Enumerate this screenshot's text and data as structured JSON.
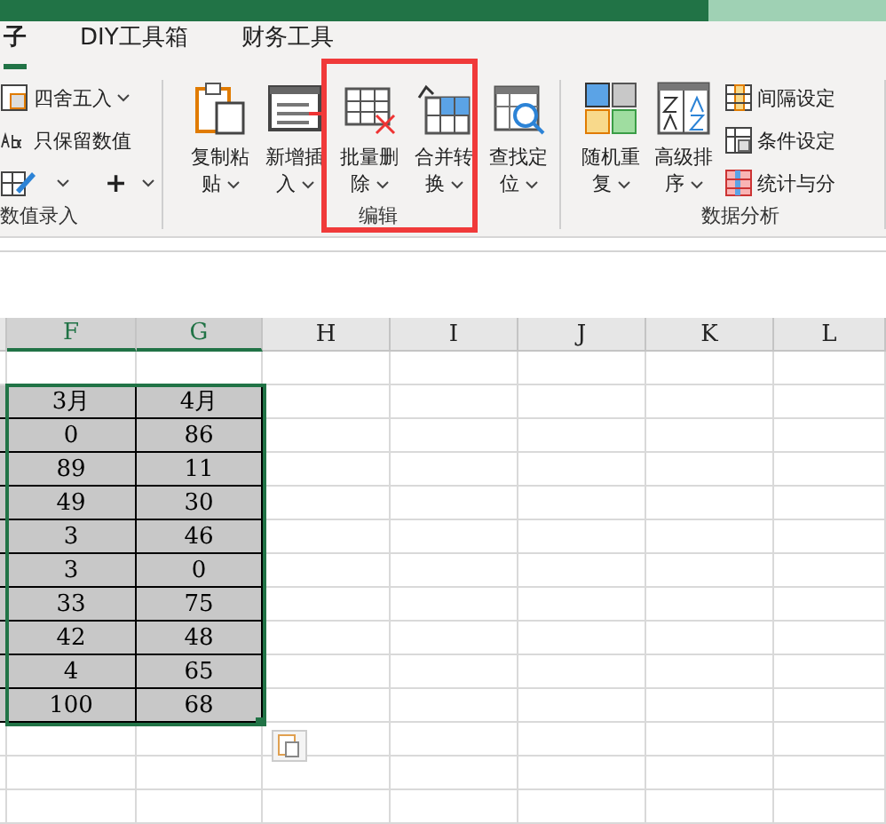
{
  "ribbon": {
    "tabs": [
      {
        "label": "子",
        "selected": true
      },
      {
        "label": "DIY工具箱",
        "selected": false
      },
      {
        "label": "财务工具",
        "selected": false
      }
    ],
    "groups": [
      {
        "name": "数值录入",
        "items": [
          {
            "kind": "small",
            "label": "四舍五入",
            "dropdown": true
          },
          {
            "kind": "small",
            "label": "只保留数值",
            "dropdown": false
          },
          {
            "kind": "pair",
            "label": "+",
            "dropdown": true
          }
        ]
      },
      {
        "name": "编辑",
        "items": [
          {
            "kind": "large",
            "label": "复制粘贴",
            "dropdown": true
          },
          {
            "kind": "large",
            "label": "新增插入",
            "dropdown": true
          },
          {
            "kind": "large",
            "label": "批量删除",
            "dropdown": true,
            "highlighted": true
          },
          {
            "kind": "large",
            "label": "合并转换",
            "dropdown": true,
            "highlighted": true
          },
          {
            "kind": "large",
            "label": "查找定位",
            "dropdown": true
          }
        ]
      },
      {
        "name": "数据分析",
        "items": [
          {
            "kind": "large",
            "label": "随机重复",
            "dropdown": true
          },
          {
            "kind": "large",
            "label": "高级排序",
            "dropdown": true
          },
          {
            "kind": "small",
            "label": "间隔设定",
            "dropdown": false
          },
          {
            "kind": "small",
            "label": "条件设定",
            "dropdown": false
          },
          {
            "kind": "small",
            "label": "统计与分",
            "dropdown": false
          }
        ]
      }
    ]
  },
  "sheet": {
    "columns": [
      {
        "label": "F",
        "selected": true
      },
      {
        "label": "G",
        "selected": true
      },
      {
        "label": "H",
        "selected": false
      },
      {
        "label": "I",
        "selected": false
      },
      {
        "label": "J",
        "selected": false
      },
      {
        "label": "K",
        "selected": false
      },
      {
        "label": "L",
        "selected": false
      }
    ],
    "rows": [
      {
        "selected": false,
        "cells": []
      },
      {
        "selected": true,
        "cells": [
          "3月",
          "4月"
        ]
      },
      {
        "selected": true,
        "cells": [
          "0",
          "86"
        ]
      },
      {
        "selected": true,
        "cells": [
          "89",
          "11"
        ]
      },
      {
        "selected": true,
        "cells": [
          "49",
          "30"
        ]
      },
      {
        "selected": true,
        "cells": [
          "3",
          "46"
        ]
      },
      {
        "selected": true,
        "cells": [
          "3",
          "0"
        ]
      },
      {
        "selected": true,
        "cells": [
          "33",
          "75"
        ]
      },
      {
        "selected": true,
        "cells": [
          "42",
          "48"
        ]
      },
      {
        "selected": true,
        "cells": [
          "4",
          "65"
        ]
      },
      {
        "selected": true,
        "cells": [
          "100",
          "68"
        ]
      }
    ]
  }
}
